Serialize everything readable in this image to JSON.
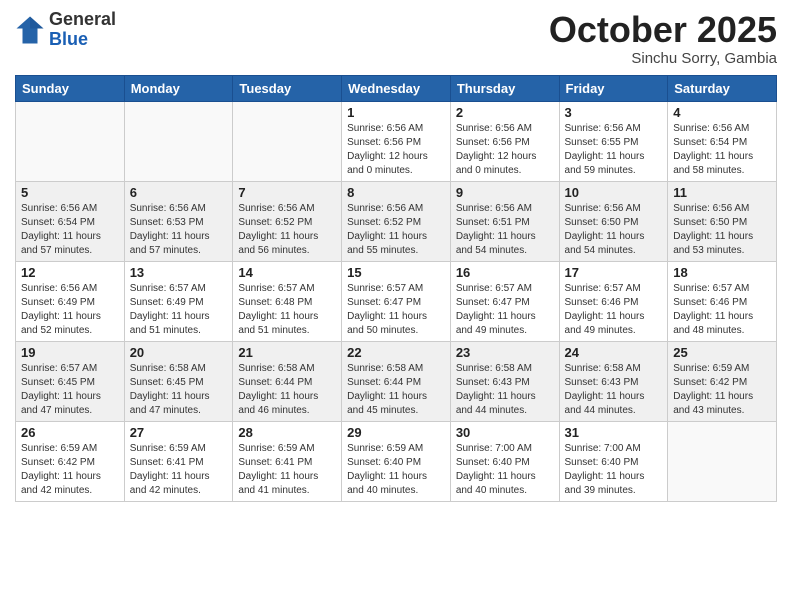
{
  "logo": {
    "general": "General",
    "blue": "Blue"
  },
  "header": {
    "month": "October 2025",
    "location": "Sinchu Sorry, Gambia"
  },
  "weekdays": [
    "Sunday",
    "Monday",
    "Tuesday",
    "Wednesday",
    "Thursday",
    "Friday",
    "Saturday"
  ],
  "weeks": [
    [
      {
        "day": "",
        "info": ""
      },
      {
        "day": "",
        "info": ""
      },
      {
        "day": "",
        "info": ""
      },
      {
        "day": "1",
        "info": "Sunrise: 6:56 AM\nSunset: 6:56 PM\nDaylight: 12 hours\nand 0 minutes."
      },
      {
        "day": "2",
        "info": "Sunrise: 6:56 AM\nSunset: 6:56 PM\nDaylight: 12 hours\nand 0 minutes."
      },
      {
        "day": "3",
        "info": "Sunrise: 6:56 AM\nSunset: 6:55 PM\nDaylight: 11 hours\nand 59 minutes."
      },
      {
        "day": "4",
        "info": "Sunrise: 6:56 AM\nSunset: 6:54 PM\nDaylight: 11 hours\nand 58 minutes."
      }
    ],
    [
      {
        "day": "5",
        "info": "Sunrise: 6:56 AM\nSunset: 6:54 PM\nDaylight: 11 hours\nand 57 minutes."
      },
      {
        "day": "6",
        "info": "Sunrise: 6:56 AM\nSunset: 6:53 PM\nDaylight: 11 hours\nand 57 minutes."
      },
      {
        "day": "7",
        "info": "Sunrise: 6:56 AM\nSunset: 6:52 PM\nDaylight: 11 hours\nand 56 minutes."
      },
      {
        "day": "8",
        "info": "Sunrise: 6:56 AM\nSunset: 6:52 PM\nDaylight: 11 hours\nand 55 minutes."
      },
      {
        "day": "9",
        "info": "Sunrise: 6:56 AM\nSunset: 6:51 PM\nDaylight: 11 hours\nand 54 minutes."
      },
      {
        "day": "10",
        "info": "Sunrise: 6:56 AM\nSunset: 6:50 PM\nDaylight: 11 hours\nand 54 minutes."
      },
      {
        "day": "11",
        "info": "Sunrise: 6:56 AM\nSunset: 6:50 PM\nDaylight: 11 hours\nand 53 minutes."
      }
    ],
    [
      {
        "day": "12",
        "info": "Sunrise: 6:56 AM\nSunset: 6:49 PM\nDaylight: 11 hours\nand 52 minutes."
      },
      {
        "day": "13",
        "info": "Sunrise: 6:57 AM\nSunset: 6:49 PM\nDaylight: 11 hours\nand 51 minutes."
      },
      {
        "day": "14",
        "info": "Sunrise: 6:57 AM\nSunset: 6:48 PM\nDaylight: 11 hours\nand 51 minutes."
      },
      {
        "day": "15",
        "info": "Sunrise: 6:57 AM\nSunset: 6:47 PM\nDaylight: 11 hours\nand 50 minutes."
      },
      {
        "day": "16",
        "info": "Sunrise: 6:57 AM\nSunset: 6:47 PM\nDaylight: 11 hours\nand 49 minutes."
      },
      {
        "day": "17",
        "info": "Sunrise: 6:57 AM\nSunset: 6:46 PM\nDaylight: 11 hours\nand 49 minutes."
      },
      {
        "day": "18",
        "info": "Sunrise: 6:57 AM\nSunset: 6:46 PM\nDaylight: 11 hours\nand 48 minutes."
      }
    ],
    [
      {
        "day": "19",
        "info": "Sunrise: 6:57 AM\nSunset: 6:45 PM\nDaylight: 11 hours\nand 47 minutes."
      },
      {
        "day": "20",
        "info": "Sunrise: 6:58 AM\nSunset: 6:45 PM\nDaylight: 11 hours\nand 47 minutes."
      },
      {
        "day": "21",
        "info": "Sunrise: 6:58 AM\nSunset: 6:44 PM\nDaylight: 11 hours\nand 46 minutes."
      },
      {
        "day": "22",
        "info": "Sunrise: 6:58 AM\nSunset: 6:44 PM\nDaylight: 11 hours\nand 45 minutes."
      },
      {
        "day": "23",
        "info": "Sunrise: 6:58 AM\nSunset: 6:43 PM\nDaylight: 11 hours\nand 44 minutes."
      },
      {
        "day": "24",
        "info": "Sunrise: 6:58 AM\nSunset: 6:43 PM\nDaylight: 11 hours\nand 44 minutes."
      },
      {
        "day": "25",
        "info": "Sunrise: 6:59 AM\nSunset: 6:42 PM\nDaylight: 11 hours\nand 43 minutes."
      }
    ],
    [
      {
        "day": "26",
        "info": "Sunrise: 6:59 AM\nSunset: 6:42 PM\nDaylight: 11 hours\nand 42 minutes."
      },
      {
        "day": "27",
        "info": "Sunrise: 6:59 AM\nSunset: 6:41 PM\nDaylight: 11 hours\nand 42 minutes."
      },
      {
        "day": "28",
        "info": "Sunrise: 6:59 AM\nSunset: 6:41 PM\nDaylight: 11 hours\nand 41 minutes."
      },
      {
        "day": "29",
        "info": "Sunrise: 6:59 AM\nSunset: 6:40 PM\nDaylight: 11 hours\nand 40 minutes."
      },
      {
        "day": "30",
        "info": "Sunrise: 7:00 AM\nSunset: 6:40 PM\nDaylight: 11 hours\nand 40 minutes."
      },
      {
        "day": "31",
        "info": "Sunrise: 7:00 AM\nSunset: 6:40 PM\nDaylight: 11 hours\nand 39 minutes."
      },
      {
        "day": "",
        "info": ""
      }
    ]
  ]
}
